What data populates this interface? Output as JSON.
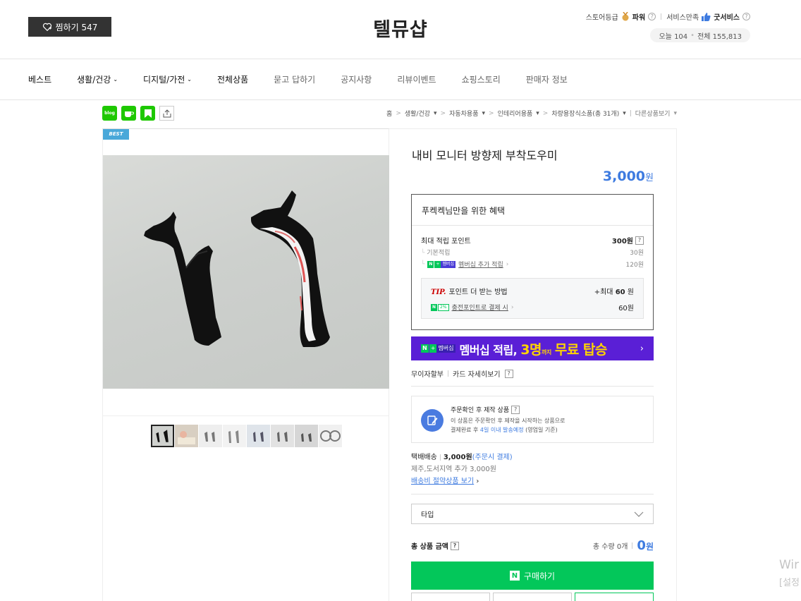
{
  "header": {
    "favorite_label": "찜하기 547",
    "store_name": "텔뮤샵",
    "store_grade_label": "스토어등급",
    "store_grade_value": "파워",
    "service_label": "서비스만족",
    "service_value": "굿서비스",
    "today_label": "오늘 104",
    "total_label": "전체 155,813"
  },
  "nav": {
    "items": [
      {
        "label": "베스트"
      },
      {
        "label": "생활/건강"
      },
      {
        "label": "디지털/가전"
      },
      {
        "label": "전체상품"
      },
      {
        "label": "묻고 답하기"
      },
      {
        "label": "공지사항"
      },
      {
        "label": "리뷰이벤트"
      },
      {
        "label": "쇼핑스토리"
      },
      {
        "label": "판매자 정보"
      }
    ]
  },
  "share": {
    "blog_label": "blog"
  },
  "breadcrumb": {
    "items": [
      "홈",
      "생활/건강",
      "자동차용품",
      "인테리어용품",
      "차량용장식소품(총 31개)"
    ],
    "more_label": "다른상품보기"
  },
  "gallery": {
    "badge": "BEST",
    "thumb_count": 8
  },
  "product": {
    "title": "내비 모니터 방향제 부착도우미",
    "price": "3,000",
    "price_unit": "원"
  },
  "benefits": {
    "title": "푸켁켁님만을 위한 혜택",
    "max_points_label": "최대 적립 포인트",
    "max_points_value": "300원",
    "base_label": "기본적립",
    "base_value": "30원",
    "membership_badge": "멤버십",
    "membership_label": "멤버십 추가 적립",
    "membership_value": "120원",
    "tip_label": "TIP.",
    "tip_text": "포인트 더 받는 방법",
    "tip_max_prefix": "+최대",
    "tip_max_value": "60",
    "tip_max_unit": "원",
    "charge_badge": "2%",
    "charge_label": "충전포인트로 결제 시",
    "charge_value": "60원"
  },
  "banner": {
    "badge": "멤버십",
    "text_prefix": "멤버십 적립,",
    "text_highlight": "3명",
    "text_small": "까지",
    "text_suffix": "무료 탑승"
  },
  "card_links": {
    "installment": "무이자할부",
    "card_detail": "카드 자세히보기"
  },
  "notice": {
    "title": "주문확인 후 제작 상품",
    "line1": "이 상품은 주문확인 후 제작을 시작하는 상품으로",
    "line2_prefix": "결제완료 후",
    "line2_highlight": "4일 이내 발송예정",
    "line2_suffix": "(영업일 기준)"
  },
  "shipping": {
    "method": "택배배송",
    "fee": "3,000원",
    "fee_note": "(주문시 결제)",
    "extra": "제주,도서지역 추가 3,000원",
    "saving_link": "배송비 절약상품 보기"
  },
  "option": {
    "placeholder": "타입"
  },
  "total": {
    "label": "총 상품 금액",
    "qty_label": "총 수량 0개",
    "amount": "0",
    "unit": "원"
  },
  "buy": {
    "n_mark": "N",
    "label": "구매하기"
  },
  "watermark": {
    "line1": "Wir",
    "line2": "[설정"
  },
  "colors": {
    "accent_blue": "#3e7be0",
    "naver_green": "#03c75a",
    "banner_purple": "#5a1fd6",
    "best_badge": "#49a8d9"
  }
}
